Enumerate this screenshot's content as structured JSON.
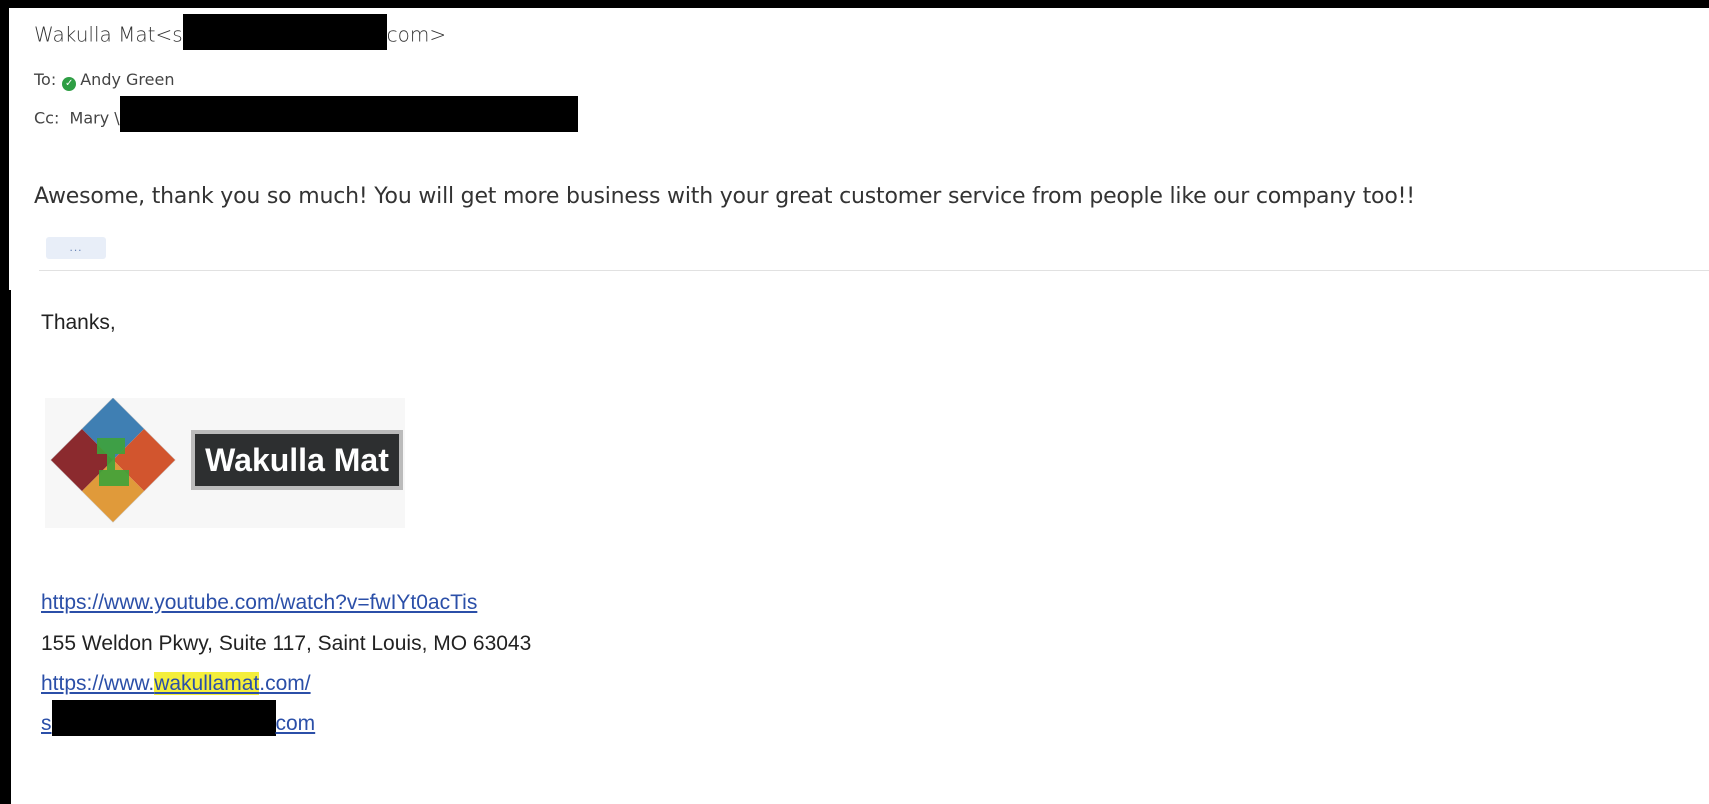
{
  "header": {
    "from_name": "Wakulla Mat",
    "from_email_start": "<s",
    "from_email_end": "com>",
    "to_label": "To:",
    "to_name": "Andy Green",
    "cc_label": "Cc:",
    "cc_name_partial": "Mary \\"
  },
  "message": {
    "body": "Awesome, thank you so much! You will get more business with your great customer service from people like our company too!!",
    "expand_label": "..."
  },
  "signature": {
    "thanks": "Thanks,",
    "logo_text": "Wakulla Mat",
    "youtube_link": "https://www.youtube.com/watch?v=fwIYt0acTis",
    "address": "155 Weldon Pkwy, Suite 117, Saint Louis, MO 63043",
    "site_prefix": "https://www.",
    "site_highlight": "wakullamat",
    "site_suffix": ".com/",
    "email_start": "s",
    "email_end": "com"
  },
  "colors": {
    "link": "#2b4fa8",
    "highlight": "#f4ee3b",
    "status_dot": "#2e9e44"
  }
}
